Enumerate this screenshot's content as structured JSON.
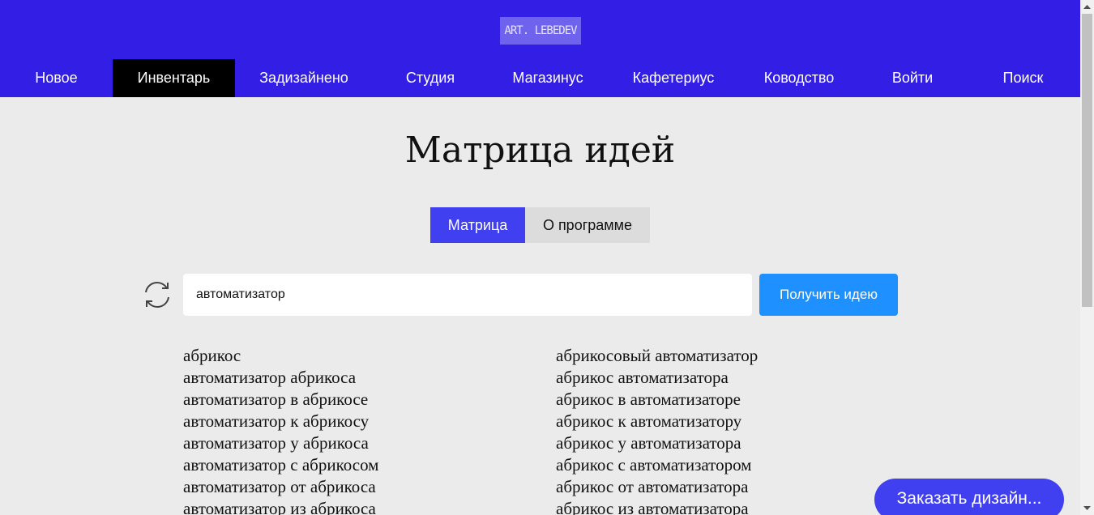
{
  "header": {
    "logo_text": "ART. LEBEDEV",
    "brand_color": "#331ee6",
    "nav": [
      {
        "label": "Новое",
        "active": false
      },
      {
        "label": "Инвентарь",
        "active": true
      },
      {
        "label": "Задизайнено",
        "active": false
      },
      {
        "label": "Студия",
        "active": false
      },
      {
        "label": "Магазинус",
        "active": false
      },
      {
        "label": "Кафетериус",
        "active": false
      },
      {
        "label": "Ководство",
        "active": false
      },
      {
        "label": "Войти",
        "active": false
      },
      {
        "label": "Поиск",
        "active": false
      }
    ]
  },
  "main": {
    "title": "Матрица идей",
    "tabs": [
      {
        "label": "Матрица",
        "active": true
      },
      {
        "label": "О программе",
        "active": false
      }
    ],
    "search": {
      "value": "автоматизатор",
      "refresh_icon": "refresh-icon"
    },
    "submit_label": "Получить идею",
    "results": {
      "left": [
        "абрикос",
        "автоматизатор абрикоса",
        "автоматизатор в абрикосе",
        "автоматизатор к абрикосу",
        "автоматизатор у абрикоса",
        "автоматизатор с абрикосом",
        "автоматизатор от абрикоса",
        "автоматизатор из абрикоса"
      ],
      "right": [
        "абрикосовый автоматизатор",
        "абрикос автоматизатора",
        "абрикос в автоматизаторе",
        "абрикос к автоматизатору",
        "абрикос у автоматизатора",
        "абрикос с автоматизатором",
        "абрикос от автоматизатора",
        "абрикос из автоматизатора"
      ]
    }
  },
  "order_button": "Заказать дизайн..."
}
